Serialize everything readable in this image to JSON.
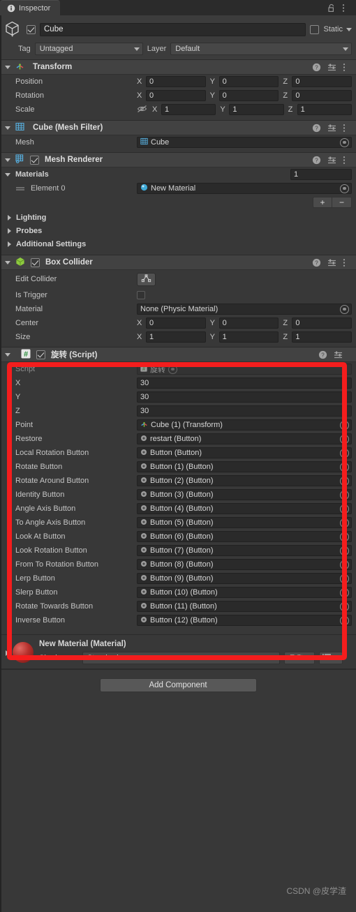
{
  "window": {
    "tab_label": "Inspector",
    "tab_icon": "info-icon",
    "lock_icon": "lock-open-icon",
    "menu_icon": "kebab-menu-icon"
  },
  "object_header": {
    "icon": "cube-icon",
    "enabled": true,
    "name": "Cube",
    "static_label": "Static",
    "static_checked": false,
    "tag_label": "Tag",
    "tag_value": "Untagged",
    "layer_label": "Layer",
    "layer_value": "Default"
  },
  "transform": {
    "title": "Transform",
    "icon": "transform-axis-icon",
    "rows": [
      {
        "label": "Position",
        "x": "0",
        "y": "0",
        "z": "0",
        "locked_icon": false
      },
      {
        "label": "Rotation",
        "x": "0",
        "y": "0",
        "z": "0",
        "locked_icon": false
      },
      {
        "label": "Scale",
        "x": "1",
        "y": "1",
        "z": "1",
        "locked_icon": true
      }
    ],
    "axis_x": "X",
    "axis_y": "Y",
    "axis_z": "Z"
  },
  "mesh_filter": {
    "title": "Cube (Mesh Filter)",
    "icon": "mesh-filter-icon",
    "mesh_label": "Mesh",
    "mesh_value": "Cube"
  },
  "mesh_renderer": {
    "title": "Mesh Renderer",
    "icon": "mesh-renderer-icon",
    "enabled": true,
    "materials_label": "Materials",
    "materials_size": "1",
    "element_label": "Element 0",
    "element_value": "New Material",
    "plus_label": "+",
    "minus_label": "−",
    "foldouts": [
      "Lighting",
      "Probes",
      "Additional Settings"
    ]
  },
  "box_collider": {
    "title": "Box Collider",
    "icon": "box-collider-icon",
    "enabled": true,
    "edit_collider_label": "Edit Collider",
    "edit_collider_icon": "edit-collider-icon",
    "is_trigger_label": "Is Trigger",
    "is_trigger_checked": false,
    "material_label": "Material",
    "material_value": "None (Physic Material)",
    "center_label": "Center",
    "center": {
      "x": "0",
      "y": "0",
      "z": "0"
    },
    "size_label": "Size",
    "size": {
      "x": "1",
      "y": "1",
      "z": "1"
    }
  },
  "script_component": {
    "title": "旋转 (Script)",
    "icon": "csharp-script-icon",
    "enabled": true,
    "script_label": "Script",
    "script_value": "旋转",
    "numeric_rows": [
      {
        "label": "X",
        "value": "30"
      },
      {
        "label": "Y",
        "value": "30"
      },
      {
        "label": "Z",
        "value": "30"
      }
    ],
    "object_rows": [
      {
        "label": "Point",
        "value": "Cube (1) (Transform)",
        "icon": "transform-axis-icon"
      },
      {
        "label": "Restore",
        "value": "restart (Button)",
        "icon": "button-icon"
      },
      {
        "label": "Local Rotation Button",
        "value": "Button (Button)",
        "icon": "button-icon"
      },
      {
        "label": "Rotate Button",
        "value": "Button (1) (Button)",
        "icon": "button-icon"
      },
      {
        "label": "Rotate Around Button",
        "value": "Button (2) (Button)",
        "icon": "button-icon"
      },
      {
        "label": "Identity Button",
        "value": "Button (3) (Button)",
        "icon": "button-icon"
      },
      {
        "label": "Angle Axis Button",
        "value": "Button (4) (Button)",
        "icon": "button-icon"
      },
      {
        "label": "To Angle Axis Button",
        "value": "Button (5) (Button)",
        "icon": "button-icon"
      },
      {
        "label": "Look At Button",
        "value": "Button (6) (Button)",
        "icon": "button-icon"
      },
      {
        "label": "Look Rotation Button",
        "value": "Button (7) (Button)",
        "icon": "button-icon"
      },
      {
        "label": "From To Rotation Button",
        "value": "Button (8) (Button)",
        "icon": "button-icon"
      },
      {
        "label": "Lerp Button",
        "value": "Button (9) (Button)",
        "icon": "button-icon"
      },
      {
        "label": "Slerp Button",
        "value": "Button (10) (Button)",
        "icon": "button-icon"
      },
      {
        "label": "Rotate Towards Button",
        "value": "Button (11) (Button)",
        "icon": "button-icon"
      },
      {
        "label": "Inverse Button",
        "value": "Button (12) (Button)",
        "icon": "button-icon"
      }
    ]
  },
  "material_preview": {
    "title": "New Material (Material)",
    "shader_label": "Shader",
    "shader_value": "Standard",
    "edit_label": "Edit...",
    "preset_icon": "preset-list-icon"
  },
  "add_component": {
    "label": "Add Component"
  },
  "watermark": {
    "text": "CSDN @皮学渣"
  },
  "colors": {
    "highlight": "#f41d1d",
    "panel_bg": "#383838",
    "header_bg": "#424242",
    "field_bg": "#2a2a2a"
  }
}
